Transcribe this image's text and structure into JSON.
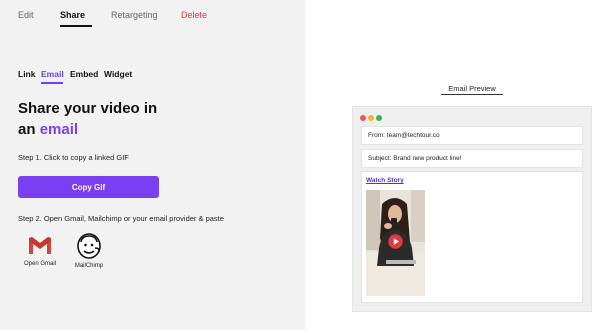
{
  "top_tabs": [
    {
      "label": "Edit"
    },
    {
      "label": "Share"
    },
    {
      "label": "Retargeting"
    },
    {
      "label": "Delete"
    }
  ],
  "sub_tabs": [
    {
      "label": "Link"
    },
    {
      "label": "Email"
    },
    {
      "label": "Embed"
    },
    {
      "label": "Widget"
    }
  ],
  "heading": {
    "prefix": "Share your video in",
    "line2_prefix": "an",
    "accent": "email"
  },
  "step1": "Step 1. Click to copy a linked GIF",
  "copy_button": "Copy Gif",
  "step2": "Step 2. Open Gmail, Mailchimp or your email provider & paste",
  "apps": [
    {
      "label": "Open Gmail",
      "icon": "gmail-icon"
    },
    {
      "label": "MailChimp",
      "icon": "mailchimp-icon"
    }
  ],
  "preview": {
    "title": "Email Preview",
    "from": "From: team@techtour.co",
    "subject": "Subject: Brand new product line!",
    "link": "Watch Story"
  },
  "colors": {
    "accent": "#7a3ff0",
    "delete": "#d93a3a",
    "window_red": "#ec5a4f",
    "window_yellow": "#f3b12e",
    "window_green": "#3eb34d"
  }
}
